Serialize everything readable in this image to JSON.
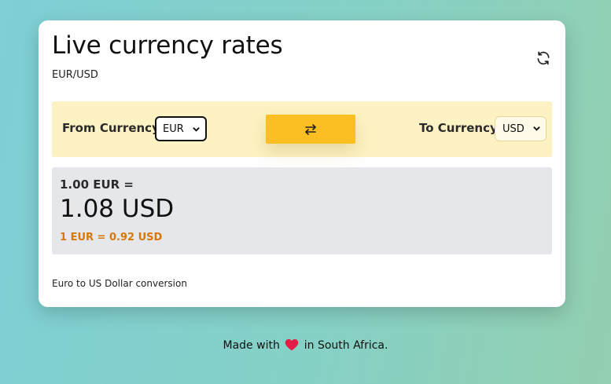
{
  "card": {
    "title": "Live currency rates",
    "pair": "EUR/USD",
    "refresh_icon": "refresh-icon"
  },
  "controls": {
    "from_label": "From Currency",
    "from_value": "EUR",
    "to_label": "To Currency",
    "to_value": "USD",
    "swap_icon": "swap-arrows-icon"
  },
  "result": {
    "amount_line": "1.00 EUR =",
    "converted": "1.08 USD",
    "rate_line": "1 EUR = 0.92 USD"
  },
  "description": "Euro to US Dollar conversion",
  "footer": {
    "before": "Made with",
    "after": "in South Africa.",
    "heart_icon": "heart-icon"
  },
  "colors": {
    "accent": "#fbbf24",
    "controls_bg": "#fdf2c4",
    "result_bg": "#e5e7eb",
    "rate_text": "#d97706",
    "heart": "#e11d48"
  }
}
